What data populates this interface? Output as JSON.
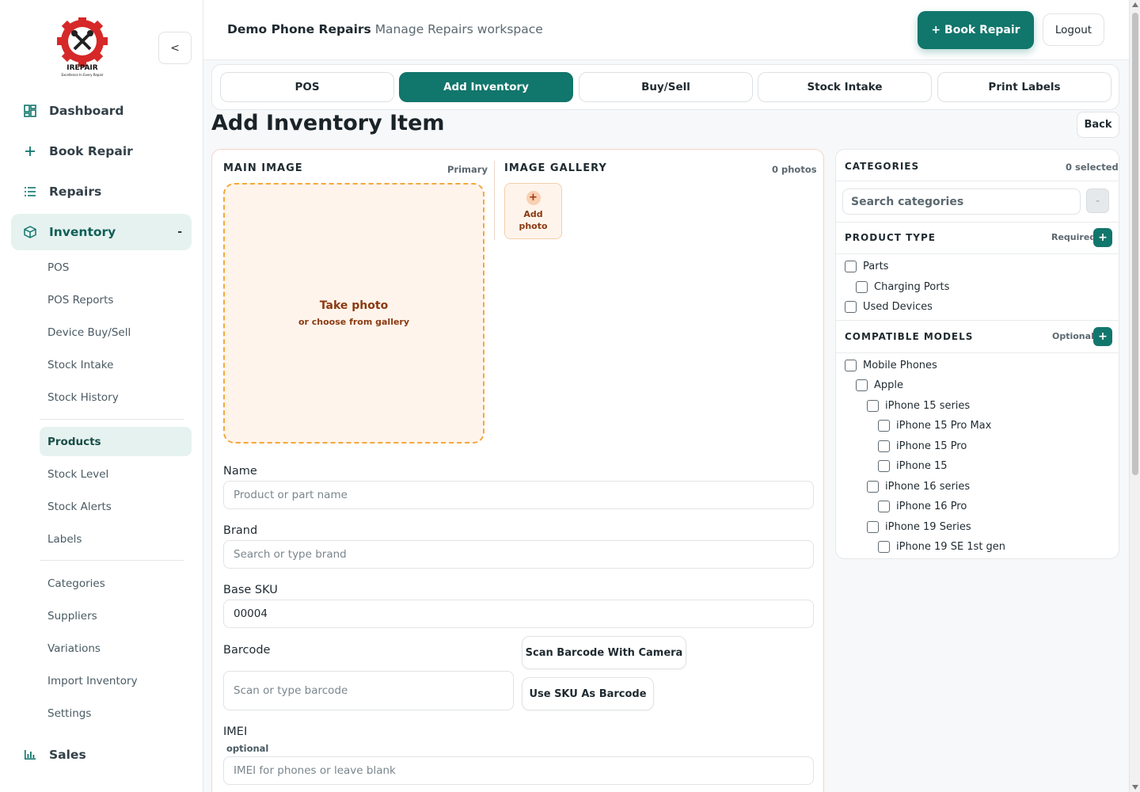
{
  "brand": {
    "logo_text": "IREPAIR",
    "logo_tagline": "Excellence In Every Repair"
  },
  "sidebar": {
    "collapse_label": "<",
    "main": [
      {
        "label": "Dashboard",
        "icon": "dashboard-icon"
      },
      {
        "label": "Book Repair",
        "icon": "plus-icon"
      },
      {
        "label": "Repairs",
        "icon": "list-icon"
      },
      {
        "label": "Inventory",
        "icon": "box-icon",
        "toggle": "-"
      }
    ],
    "inventory_items": [
      "POS",
      "POS Reports",
      "Device Buy/Sell",
      "Stock Intake",
      "Stock History"
    ],
    "product_items": [
      "Products",
      "Stock Level",
      "Stock Alerts",
      "Labels"
    ],
    "settings_items": [
      "Categories",
      "Suppliers",
      "Variations",
      "Import Inventory",
      "Settings"
    ],
    "sales": {
      "label": "Sales",
      "icon": "bar-chart-icon"
    }
  },
  "header": {
    "workspace_name": "Demo Phone Repairs",
    "workspace_sub": "Manage Repairs workspace",
    "book_repair": "+ Book Repair",
    "logout": "Logout"
  },
  "tabs": [
    "POS",
    "Add Inventory",
    "Buy/Sell",
    "Stock Intake",
    "Print Labels"
  ],
  "active_tab": "Add Inventory",
  "page": {
    "title": "Add Inventory Item",
    "back": "Back"
  },
  "media": {
    "main_image_label": "MAIN IMAGE",
    "main_image_meta": "Primary",
    "gallery_label": "IMAGE GALLERY",
    "gallery_meta": "0 photos",
    "take_photo": "Take photo",
    "choose_gallery": "or choose from gallery",
    "add_photo": "Add photo"
  },
  "form": {
    "name": {
      "label": "Name",
      "placeholder": "Product or part name"
    },
    "brand": {
      "label": "Brand",
      "placeholder": "Search or type brand"
    },
    "sku": {
      "label": "Base SKU",
      "value": "00004"
    },
    "barcode": {
      "label": "Barcode",
      "placeholder": "Scan or type barcode",
      "scan_button": "Scan Barcode With Camera",
      "use_sku_button": "Use SKU As Barcode"
    },
    "imei": {
      "label": "IMEI",
      "sub": "optional",
      "placeholder": "IMEI for phones or leave blank"
    }
  },
  "categories": {
    "title": "CATEGORIES",
    "selected": "0 selected",
    "search_placeholder": "Search categories",
    "collapse": "-",
    "product_type": {
      "title": "PRODUCT TYPE",
      "meta": "Required",
      "items": [
        "Parts",
        "Charging Ports",
        "Used Devices"
      ]
    },
    "compatible": {
      "title": "COMPATIBLE MODELS",
      "meta": "Optional",
      "items": [
        "Mobile Phones",
        "Apple",
        "iPhone 15 series",
        "iPhone 15 Pro Max",
        "iPhone 15 Pro",
        "iPhone 15",
        "iPhone 16 series",
        "iPhone 16 Pro",
        "iPhone 19 Series",
        "iPhone 19 SE 1st gen"
      ]
    }
  },
  "colors": {
    "primary": "#11766c",
    "accent_orange": "#f2a93b",
    "photo_bg": "#fff4eb"
  }
}
